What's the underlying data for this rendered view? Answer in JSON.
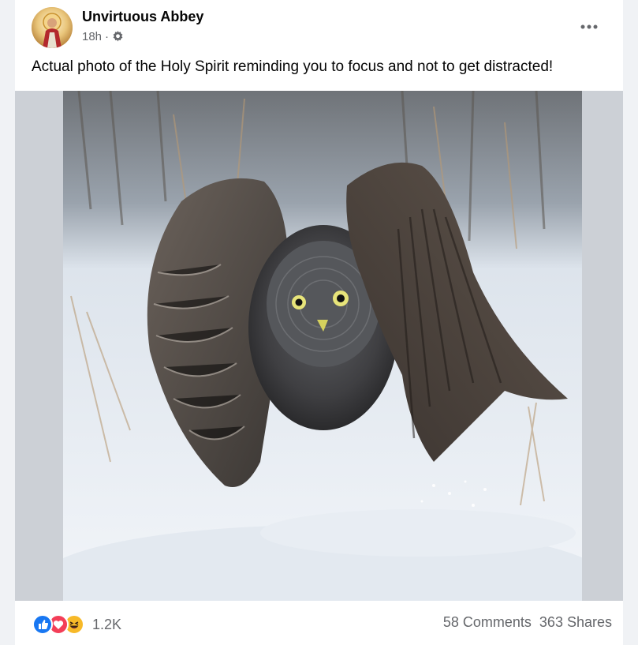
{
  "post": {
    "author": "Unvirtuous Abbey",
    "time": "18h",
    "separator": "·",
    "caption": "Actual photo of the Holy Spirit reminding you to focus and not to get distracted!",
    "more_icon": "more-options-icon",
    "privacy_icon": "gear-icon"
  },
  "reactions": {
    "icons": [
      "like-icon",
      "love-icon",
      "haha-icon"
    ],
    "count": "1.2K",
    "comments": "58 Comments",
    "shares": "363 Shares"
  },
  "colors": {
    "like": "#1877f2",
    "love": "#f33e58",
    "haha": "#f7b928",
    "secondary_text": "#65676b"
  }
}
